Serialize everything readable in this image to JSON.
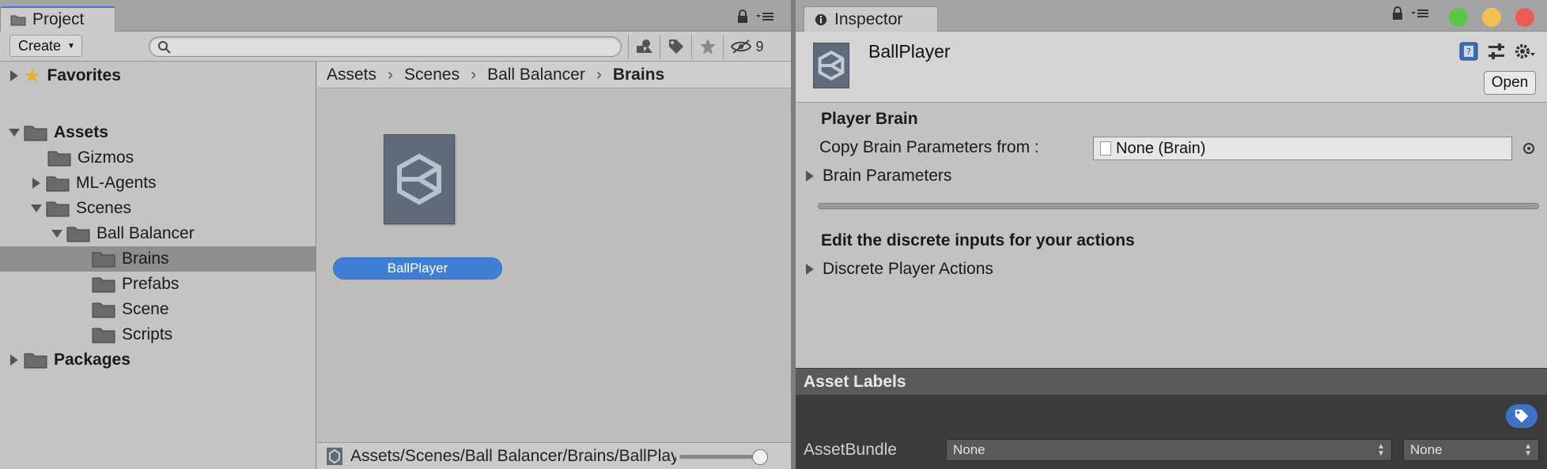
{
  "project_panel": {
    "tab_label": "Project",
    "create_label": "Create",
    "search_placeholder": "",
    "hidden_count": "9",
    "tree": {
      "favorites": "Favorites",
      "assets": "Assets",
      "gizmos": "Gizmos",
      "ml_agents": "ML-Agents",
      "scenes": "Scenes",
      "ball_balancer": "Ball Balancer",
      "brains": "Brains",
      "prefabs": "Prefabs",
      "scene": "Scene",
      "scripts": "Scripts",
      "packages": "Packages"
    },
    "breadcrumb": [
      "Assets",
      "Scenes",
      "Ball Balancer",
      "Brains"
    ],
    "asset_name": "BallPlayer",
    "status_path": "Assets/Scenes/Ball Balancer/Brains/BallPlayer.asset"
  },
  "inspector": {
    "tab_label": "Inspector",
    "title": "BallPlayer",
    "open_label": "Open",
    "player_brain_header": "Player Brain",
    "copy_label": "Copy Brain Parameters from :",
    "copy_value": "None (Brain)",
    "brain_params_label": "Brain Parameters",
    "discrete_header": "Edit the discrete inputs for your actions",
    "discrete_actions_label": "Discrete Player Actions",
    "asset_labels_title": "Asset Labels",
    "assetbundle_label": "AssetBundle",
    "bundle_value": "None",
    "variant_value": "None"
  },
  "colors": {
    "accent_blue": "#3f7fd6",
    "close": "#ec5b55",
    "minimize": "#f4bf4f",
    "maximize": "#5dc548"
  },
  "icons": [
    "folder-icon",
    "star-icon",
    "unity-logo-icon",
    "lock-icon",
    "menu-icon",
    "search-icon",
    "filter-by-type-icon",
    "tag-icon",
    "star-filter-icon",
    "hidden-eye-icon",
    "help-book-icon",
    "preset-icon",
    "gear-icon",
    "object-picker-icon"
  ]
}
